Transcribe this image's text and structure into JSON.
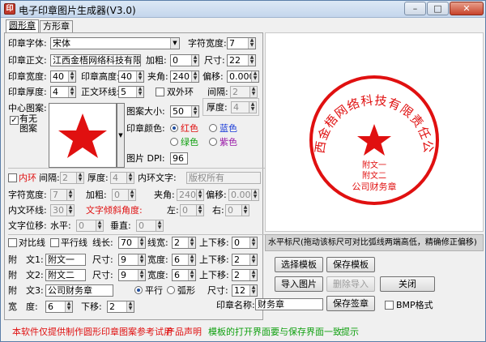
{
  "app": {
    "title": "电子印章图片生成器(V3.0)",
    "icon_name": "stamp-app-icon",
    "window_buttons": {
      "minimize": "–",
      "maximize": "□",
      "close": "✕"
    }
  },
  "tabs": [
    {
      "label": "圆形章",
      "active": true
    },
    {
      "label": "方形章",
      "active": false
    }
  ],
  "form": {
    "font_label": "印章字体:",
    "font_value": "宋体",
    "char_width_label": "字符宽度:",
    "char_width_value": "7",
    "text_label": "印章正文:",
    "text_value": "江西金梧网络科技有限责",
    "bold_label": "加粗:",
    "bold_value": "0",
    "size_label": "尺寸:",
    "size_value": "22",
    "stamp_width_label": "印章宽度:",
    "stamp_width_value": "40",
    "stamp_height_label": "印章高度:",
    "stamp_height_value": "40",
    "angle_label": "夹角:",
    "angle_value": "240",
    "offset_label": "偏移:",
    "offset_value": "0.000",
    "thickness_label": "印章厚度:",
    "thickness_value": "4",
    "ring_label": "正文环线:",
    "ring_value": "5",
    "double_ring_label": "双外环",
    "gap_label": "间隔:",
    "gap_value": "2",
    "double_thick_label": "厚度:",
    "double_thick_value": "4",
    "center_pattern_label": "中心图案:",
    "has_pattern_label": "有无图案",
    "pattern_size_label": "图案大小:",
    "pattern_size_value": "50",
    "color_label": "印章颜色:",
    "colors": [
      {
        "label": "红色",
        "color": "#e01010",
        "selected": true
      },
      {
        "label": "蓝色",
        "color": "#1a3cd8",
        "selected": false
      },
      {
        "label": "绿色",
        "color": "#10a010",
        "selected": false
      },
      {
        "label": "紫色",
        "color": "#9a1aa8",
        "selected": false
      }
    ],
    "dpi_label": "图片 DPI:",
    "dpi_value": "96"
  },
  "inner_ring": {
    "enable_label": "内环",
    "gap_label": "间隔:",
    "gap_value": "2",
    "thick_label": "厚度:",
    "thick_value": "4",
    "text_label": "内环文字:",
    "text_value": "版权所有",
    "char_width_label": "字符宽度:",
    "char_width_value": "7",
    "bold_label": "加粗:",
    "bold_value": "0",
    "angle_label": "夹角:",
    "angle_value": "240",
    "offset_label": "偏移:",
    "offset_value": "0.000",
    "ring_label": "内文环线:",
    "ring_value": "30",
    "tilt_label": "文字倾斜角度:",
    "left_label": "左:",
    "left_value": "0",
    "right_label": "右:",
    "right_value": "0",
    "shift_label": "文字位移:",
    "horiz_label": "水平:",
    "horiz_value": "0",
    "vert_label": "垂直:",
    "vert_value": "0"
  },
  "lines": {
    "contrast_label": "对比线",
    "parallel_label": "平行线",
    "length_label": "线长:",
    "length_value": "70",
    "width_label": "线宽:",
    "width_value": "2",
    "updown_label": "上下移:",
    "updown_value": "0"
  },
  "subtexts": [
    {
      "label": "附　文1:",
      "value": "附文一",
      "size_label": "尺寸:",
      "size": "9",
      "width_label": "宽度:",
      "width": "6",
      "move_label": "上下移:",
      "move": "2"
    },
    {
      "label": "附　文2:",
      "value": "附文二",
      "size_label": "尺寸:",
      "size": "9",
      "width_label": "宽度:",
      "width": "6",
      "move_label": "上下移:",
      "move": "2"
    }
  ],
  "subtext3": {
    "label": "附　文3:",
    "value": "公司财务章",
    "parallel_label": "平行",
    "arc_label": "弧形",
    "size_label": "尺寸:",
    "size": "12",
    "width_label": "宽　度:",
    "width": "6",
    "move_label": "下移:",
    "move": "2"
  },
  "buttons": {
    "select_template": "选择模板",
    "save_template": "保存模板",
    "import_image": "导入图片",
    "delete_import": "删除导入",
    "close": "关闭",
    "save_stamp": "保存签章"
  },
  "stamp_name_label": "印章名称:",
  "stamp_name_value": "财务章",
  "bmp_label": "BMP格式",
  "preview": {
    "arc_text": "江西金梧网络科技有限责任公司",
    "sub1": "附文一",
    "sub2": "附文二",
    "sub3": "公司财务章",
    "color": "#e01010"
  },
  "hint_text": "水平标尺(拖动该标尺可对比弧线两端高低，精确修正偏移)",
  "footer": {
    "note": "本软件仅提供制作圆形印章图案参考试用",
    "declaration": "产品声明",
    "tip": "模板的打开界面要与保存界面一致",
    "hint": "提示"
  }
}
